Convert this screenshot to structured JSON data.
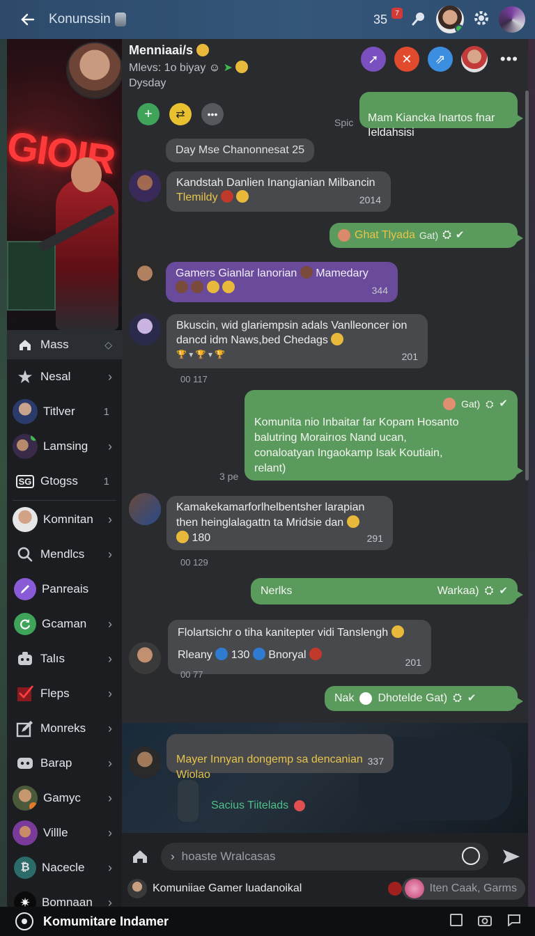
{
  "topbar": {
    "title": "Konunssin",
    "count": "35",
    "badge": "7"
  },
  "sidebar": {
    "items": [
      {
        "label": "Mass",
        "icon": "home-icon",
        "active": true
      },
      {
        "label": "Nesal",
        "icon": "star-icon",
        "arrow": true
      },
      {
        "label": "Titlver",
        "icon": "avatar-icon",
        "num": "1"
      },
      {
        "label": "Lamsing",
        "icon": "group-avatar-icon",
        "arrow": true
      },
      {
        "label": "Gtogss",
        "icon": "sgo-icon",
        "num": "1"
      },
      {
        "label": "Komnitan",
        "icon": "avatar-icon",
        "arrow": true
      },
      {
        "label": "Mendlcs",
        "icon": "search-icon",
        "arrow": true
      },
      {
        "label": "Panreais",
        "icon": "pencil-icon"
      },
      {
        "label": "Gcaman",
        "icon": "refresh-icon",
        "arrow": true
      },
      {
        "label": "Talıs",
        "icon": "gamepad-icon",
        "arrow": true
      },
      {
        "label": "Fleps",
        "icon": "check-box-icon",
        "arrow": true
      },
      {
        "label": "Monreks",
        "icon": "edit-box-icon",
        "arrow": true
      },
      {
        "label": "Barap",
        "icon": "controller-icon",
        "arrow": true
      },
      {
        "label": "Gamyc",
        "icon": "avatar-icon",
        "arrow": true
      },
      {
        "label": "Villle",
        "icon": "avatar-icon",
        "arrow": true
      },
      {
        "label": "Nacecle",
        "icon": "bitcoin-icon",
        "arrow": true
      },
      {
        "label": "Bomnaan",
        "icon": "sparkle-icon",
        "arrow": true
      }
    ]
  },
  "chat": {
    "title": "Menniaai/s",
    "subtitle": "Mlevs: 1o biyay",
    "day": "Dysday",
    "system_pill": "Day Mse Chanonnesat 25",
    "messages": [
      {
        "id": "m1",
        "text": "Mam Kiancka Inartos fnar\nIeldahsisi",
        "stamp": "Spic"
      },
      {
        "id": "m2",
        "text": "Kandstah Danlien Inangianian Milbancin",
        "text2": "Tlemildy",
        "time": "2014"
      },
      {
        "id": "m3",
        "text": "Ghat Tlyada",
        "meta": "Gat)"
      },
      {
        "id": "m4",
        "text": "Gamers Gianlar lanorian",
        "text2": "Mamedary",
        "time": "344"
      },
      {
        "id": "m5",
        "text": "Bkuscin, wid glariempsin adals Vanlleoncer ion\ndancd idm Naws,bed Chedags",
        "time": "201",
        "stamp": "00 117"
      },
      {
        "id": "m6",
        "meta": "Gat)",
        "text": "Komunita nio Inbaitar far Kopam Hosanto\nbalutring Morairıos Nand ucan,\nconaloatyan Ingaokamp Isak Koutiain,\nrelant)",
        "stamp": "3 pe"
      },
      {
        "id": "m7",
        "text": "Kamakekamarforlhelbentsher larapian\nthen heinglalagattn ta Mridsie dan",
        "text2": "180",
        "time": "291",
        "stamp": "00 129"
      },
      {
        "id": "m8",
        "text": "Nerlks",
        "meta": "Warkaa)"
      },
      {
        "id": "m9",
        "text": "Flolartsichr o tiha kanitepter vidi Tanslengh",
        "text2": "Rleany",
        "text3": "130",
        "text4": "Bnoryal",
        "time": "201",
        "stamp": "00 77"
      },
      {
        "id": "m10",
        "text": "Nak",
        "text2": "Dhotelde Gat)"
      },
      {
        "id": "m11",
        "text": "Mayer Innyan dongemp sa dencanian\nWiolao",
        "time": "337"
      }
    ],
    "photo_caption": "Sacius Tiitelads"
  },
  "composer": {
    "placeholder": "hoaste Wralcasas",
    "footer_text": "Komuniiae Gamer luadanoikal",
    "chip_text": "Iten Caak, Garms"
  },
  "system_bar": {
    "title": "Komumitare Indamer"
  },
  "colors": {
    "accent_green": "#5a9a5c",
    "accent_purple": "#6a4a9a",
    "topbar": "#34567a"
  }
}
